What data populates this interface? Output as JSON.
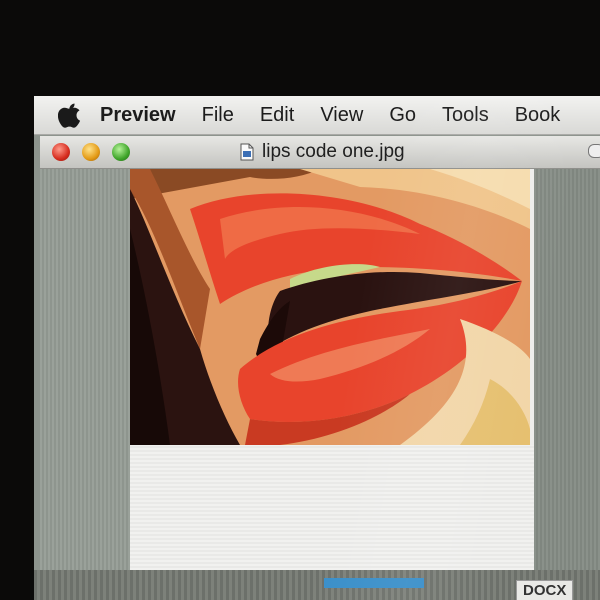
{
  "menubar": {
    "items": [
      "Preview",
      "File",
      "Edit",
      "View",
      "Go",
      "Tools",
      "Book"
    ]
  },
  "window": {
    "title": "lips code one.jpg"
  },
  "dock": {
    "badge": "DOCX"
  },
  "colors": {
    "lip_red": "#e8442c",
    "lip_highlight": "#ef7a55",
    "skin": "#e9a86e",
    "shadow": "#2a1210",
    "teeth": "#c6d98a"
  }
}
